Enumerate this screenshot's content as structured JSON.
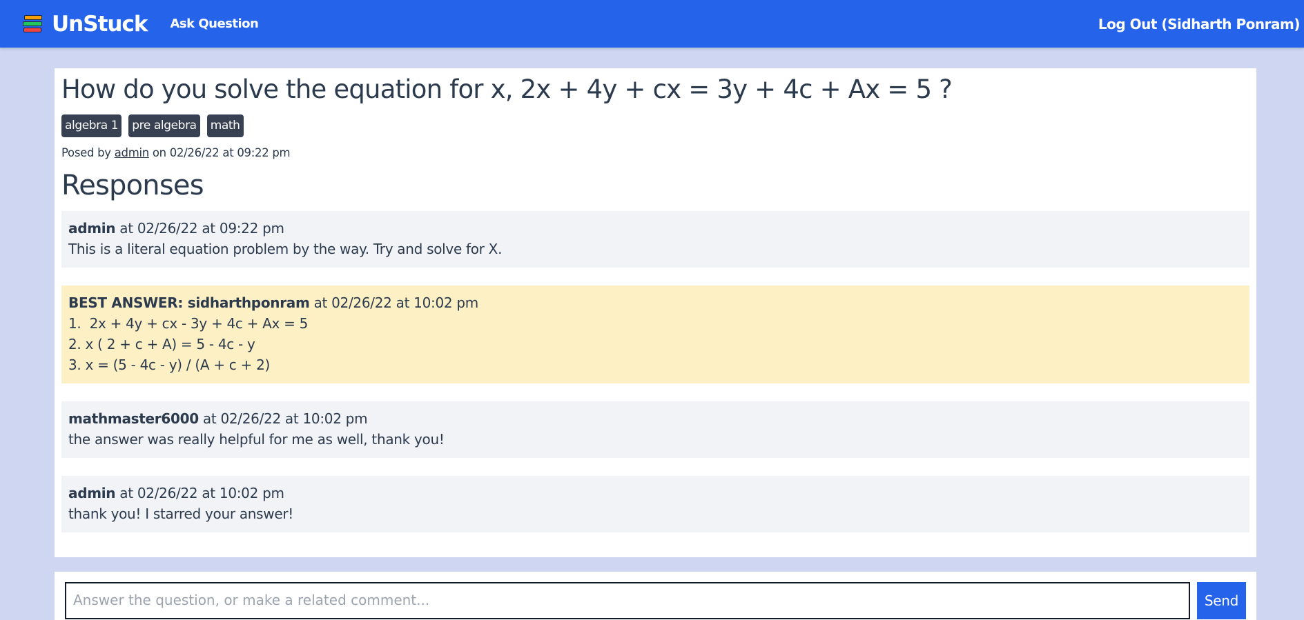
{
  "header": {
    "brand": "UnStuck",
    "ask_link": "Ask Question",
    "logout_link": "Log Out (Sidharth Ponram)",
    "accent_color": "#2563eb"
  },
  "question": {
    "title": "How do you solve the equation for x, 2x + 4y + cx = 3y + 4c + Ax = 5 ?",
    "tags": [
      "algebra 1",
      "pre algebra",
      "math"
    ],
    "posted_prefix": "Posed by",
    "author": "admin",
    "posted_suffix": "on 02/26/22 at 09:22 pm"
  },
  "responses_heading": "Responses",
  "responses": [
    {
      "prefix": "",
      "user": "admin",
      "time": " at 02/26/22 at 09:22 pm",
      "lines": [
        "This is a literal equation problem by the way. Try and solve for X."
      ]
    },
    {
      "prefix": "BEST ANSWER: ",
      "user": "sidharthponram",
      "time": " at 02/26/22 at 10:02 pm",
      "lines": [
        "1.  2x + 4y + cx - 3y + 4c + Ax = 5",
        "2. x ( 2 + c + A) = 5 - 4c - y",
        "3. x = (5 - 4c - y) / (A + c + 2)"
      ]
    },
    {
      "prefix": "",
      "user": "mathmaster6000",
      "time": " at 02/26/22 at 10:02 pm",
      "lines": [
        "the answer was really helpful for me as well, thank you!"
      ]
    },
    {
      "prefix": "",
      "user": "admin",
      "time": " at 02/26/22 at 10:02 pm",
      "lines": [
        "thank you! I starred your answer!"
      ]
    }
  ],
  "answer_form": {
    "placeholder": "Answer the question, or make a related comment...",
    "value": "",
    "send_label": "Send"
  }
}
